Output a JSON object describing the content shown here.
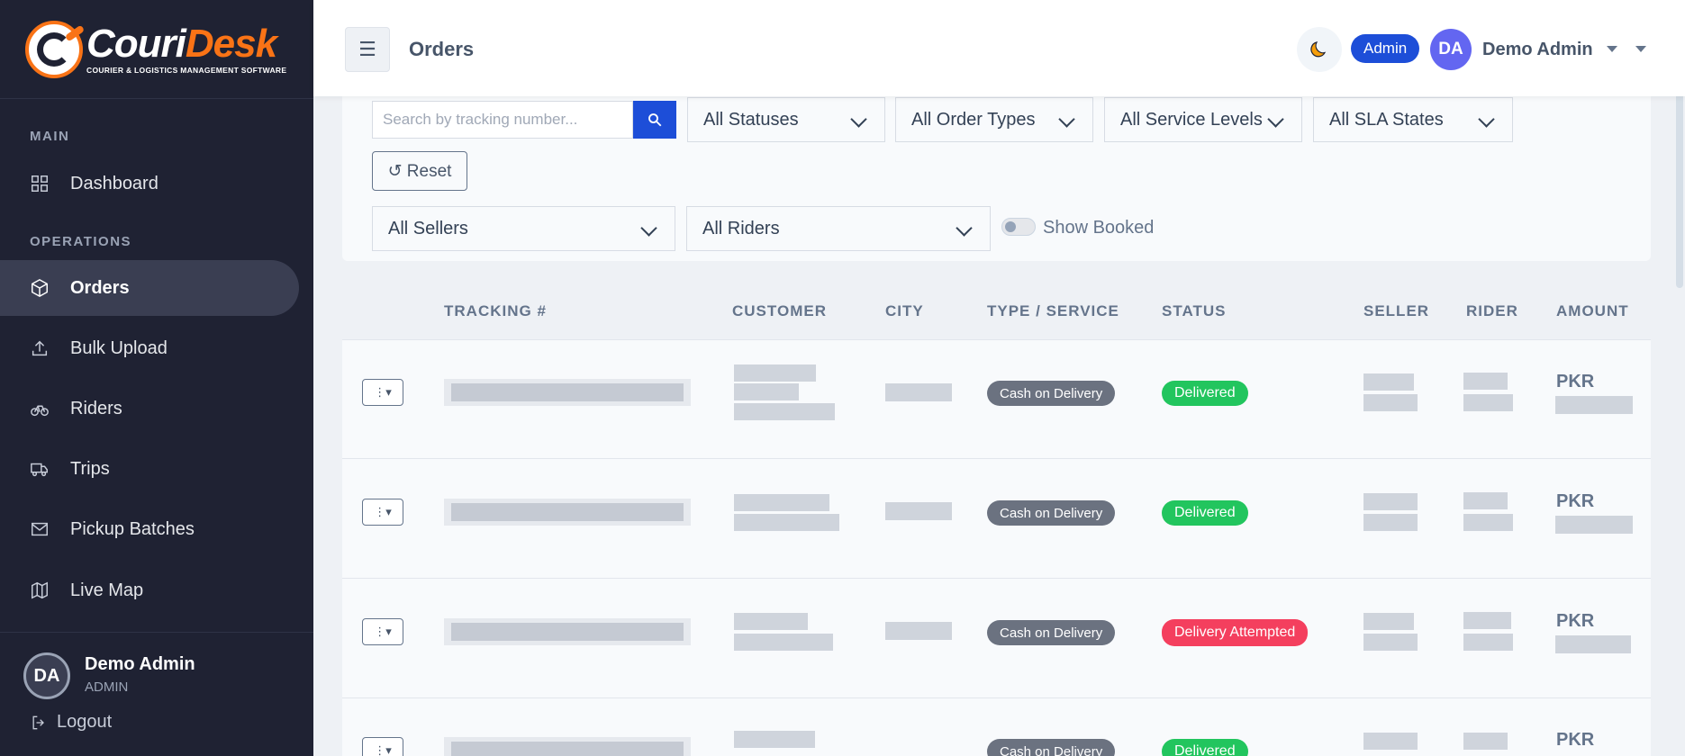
{
  "brand": {
    "name_part1": "Couri",
    "name_part2": "Desk",
    "tagline": "COURIER & LOGISTICS MANAGEMENT SOFTWARE"
  },
  "sidebar": {
    "sections": [
      {
        "label": "MAIN"
      },
      {
        "label": "OPERATIONS"
      }
    ],
    "items": [
      {
        "label": "Dashboard",
        "icon": "grid-icon"
      },
      {
        "label": "Orders",
        "icon": "package-icon",
        "active": true
      },
      {
        "label": "Bulk Upload",
        "icon": "upload-icon"
      },
      {
        "label": "Riders",
        "icon": "bicycle-icon"
      },
      {
        "label": "Trips",
        "icon": "truck-icon"
      },
      {
        "label": "Pickup Batches",
        "icon": "mail-icon"
      },
      {
        "label": "Live Map",
        "icon": "map-icon"
      }
    ],
    "user": {
      "initials": "DA",
      "name": "Demo Admin",
      "role": "ADMIN",
      "logout": "Logout"
    }
  },
  "topbar": {
    "menu_glyph": "☰",
    "title": "Orders",
    "theme_icon": "moon-icon",
    "role_badge": "Admin",
    "user_initials": "DA",
    "user_name": "Demo Admin"
  },
  "filters": {
    "search_placeholder": "Search by tracking number...",
    "statuses": "All Statuses",
    "order_types": "All Order Types",
    "service_levels": "All Service Levels",
    "sla_states": "All SLA States",
    "reset_label": "↺ Reset",
    "sellers": "All Sellers",
    "riders": "All Riders",
    "show_booked_label": "Show Booked"
  },
  "table": {
    "headers": [
      "TRACKING #",
      "CUSTOMER",
      "CITY",
      "TYPE / SERVICE",
      "STATUS",
      "SELLER",
      "RIDER",
      "AMOUNT"
    ],
    "rows": [
      {
        "type": "Cash on Delivery",
        "status": "Delivered",
        "status_color": "#22c55e",
        "currency": "PKR"
      },
      {
        "type": "Cash on Delivery",
        "status": "Delivered",
        "status_color": "#22c55e",
        "currency": "PKR"
      },
      {
        "type": "Cash on Delivery",
        "status": "Delivery Attempted",
        "status_color": "#f43f5e",
        "currency": "PKR"
      },
      {
        "type": "Cash on Delivery",
        "status": "Delivered",
        "status_color": "#22c55e",
        "currency": "PKR"
      }
    ],
    "action_glyph": "⋮▾"
  },
  "colors": {
    "sidebar_bg": "#1f2233",
    "accent": "#1d4ed8",
    "brand_orange": "#f97316"
  }
}
